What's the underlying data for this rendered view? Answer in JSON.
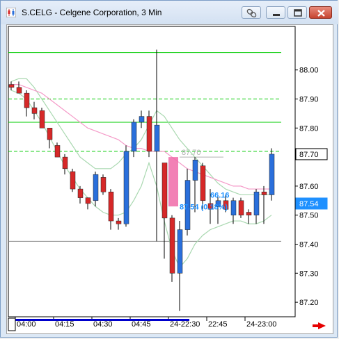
{
  "window": {
    "title": "S.CELG - Celgene Corporation, 3 Min",
    "buttons": [
      "link-icon",
      "minimize-icon",
      "maximize-icon",
      "close-icon"
    ]
  },
  "colors": {
    "up": "#2a6fdb",
    "down": "#d62828",
    "bb": "#a9d8b0",
    "ma": "#f59ac8",
    "level_green": "#00cc00",
    "highlight": "#f06aa8",
    "price_box_last": "#1e90ff",
    "scroll_arrow": "#e60000"
  },
  "chart_data": {
    "type": "candlestick",
    "symbol": "S.CELG",
    "interval": "3 Min",
    "ylim": [
      87.15,
      88.15
    ],
    "y_ticks": [
      "88.00",
      "87.90",
      "87.80",
      "87.70",
      "87.60",
      "87.50",
      "87.40",
      "87.30",
      "87.20"
    ],
    "x_tick_labels": [
      "04:00",
      "04:15",
      "04:30",
      "04:45",
      "24-22:30",
      "22:45",
      "24-23:00"
    ],
    "x_tick_index": [
      1,
      6,
      11,
      16,
      21,
      26,
      31
    ],
    "candles": [
      {
        "o": 87.95,
        "h": 87.96,
        "l": 87.93,
        "c": 87.94
      },
      {
        "o": 87.94,
        "h": 87.96,
        "l": 87.92,
        "c": 87.92
      },
      {
        "o": 87.92,
        "h": 87.93,
        "l": 87.84,
        "c": 87.87
      },
      {
        "o": 87.87,
        "h": 87.89,
        "l": 87.83,
        "c": 87.85
      },
      {
        "o": 87.86,
        "h": 87.87,
        "l": 87.8,
        "c": 87.8
      },
      {
        "o": 87.8,
        "h": 87.8,
        "l": 87.73,
        "c": 87.76
      },
      {
        "o": 87.74,
        "h": 87.75,
        "l": 87.7,
        "c": 87.7
      },
      {
        "o": 87.7,
        "h": 87.71,
        "l": 87.64,
        "c": 87.66
      },
      {
        "o": 87.65,
        "h": 87.66,
        "l": 87.58,
        "c": 87.59
      },
      {
        "o": 87.59,
        "h": 87.6,
        "l": 87.54,
        "c": 87.56
      },
      {
        "o": 87.56,
        "h": 87.56,
        "l": 87.52,
        "c": 87.54
      },
      {
        "o": 87.55,
        "h": 87.65,
        "l": 87.53,
        "c": 87.64
      },
      {
        "o": 87.63,
        "h": 87.64,
        "l": 87.57,
        "c": 87.58
      },
      {
        "o": 87.58,
        "h": 87.59,
        "l": 87.45,
        "c": 87.48
      },
      {
        "o": 87.48,
        "h": 87.49,
        "l": 87.45,
        "c": 87.47
      },
      {
        "o": 87.47,
        "h": 87.74,
        "l": 87.46,
        "c": 87.72
      },
      {
        "o": 87.72,
        "h": 87.83,
        "l": 87.7,
        "c": 87.82
      },
      {
        "o": 87.82,
        "h": 87.86,
        "l": 87.8,
        "c": 87.84
      },
      {
        "o": 87.84,
        "h": 87.86,
        "l": 87.7,
        "c": 87.72
      },
      {
        "o": 87.72,
        "h": 88.07,
        "l": 87.41,
        "c": 87.81
      },
      {
        "o": 87.68,
        "h": 87.68,
        "l": 87.35,
        "c": 87.49
      },
      {
        "o": 87.49,
        "h": 87.5,
        "l": 87.27,
        "c": 87.3
      },
      {
        "o": 87.3,
        "h": 87.48,
        "l": 87.17,
        "c": 87.45
      },
      {
        "o": 87.45,
        "h": 87.66,
        "l": 87.43,
        "c": 87.62
      },
      {
        "o": 87.62,
        "h": 87.7,
        "l": 87.51,
        "c": 87.69
      },
      {
        "o": 87.67,
        "h": 87.68,
        "l": 87.52,
        "c": 87.55
      },
      {
        "o": 87.54,
        "h": 87.59,
        "l": 87.47,
        "c": 87.52
      },
      {
        "o": 87.53,
        "h": 87.57,
        "l": 87.47,
        "c": 87.55
      },
      {
        "o": 87.55,
        "h": 87.57,
        "l": 87.51,
        "c": 87.52
      },
      {
        "o": 87.5,
        "h": 87.56,
        "l": 87.47,
        "c": 87.55
      },
      {
        "o": 87.55,
        "h": 87.56,
        "l": 87.49,
        "c": 87.5
      },
      {
        "o": 87.51,
        "h": 87.52,
        "l": 87.47,
        "c": 87.5
      },
      {
        "o": 87.5,
        "h": 87.59,
        "l": 87.47,
        "c": 87.58
      },
      {
        "o": 87.58,
        "h": 87.6,
        "l": 87.47,
        "c": 87.57
      },
      {
        "o": 87.57,
        "h": 87.73,
        "l": 87.55,
        "c": 87.71
      }
    ],
    "ma": [
      87.95,
      87.95,
      87.94,
      87.93,
      87.92,
      87.9,
      87.88,
      87.86,
      87.84,
      87.82,
      87.8,
      87.79,
      87.78,
      87.77,
      87.76,
      87.74,
      87.73,
      87.73,
      87.72,
      87.72,
      87.72,
      87.7,
      87.68,
      87.66,
      87.65,
      87.64,
      87.63,
      87.62,
      87.61,
      87.6,
      87.6,
      87.59,
      87.59,
      87.59,
      87.59
    ],
    "bb_upper": [
      87.96,
      87.97,
      87.97,
      87.94,
      87.9,
      87.86,
      87.82,
      87.78,
      87.74,
      87.7,
      87.68,
      87.66,
      87.66,
      87.66,
      87.68,
      87.71,
      87.73,
      87.76,
      87.81,
      87.86,
      87.84,
      87.8,
      87.76,
      87.73,
      87.7,
      87.67,
      87.64,
      87.61,
      87.59,
      87.58,
      87.57,
      87.57,
      87.57,
      87.57,
      87.57
    ],
    "bb_lower": [
      87.93,
      87.92,
      87.9,
      87.86,
      87.82,
      87.77,
      87.72,
      87.67,
      87.63,
      87.59,
      87.56,
      87.53,
      87.51,
      87.5,
      87.5,
      87.51,
      87.55,
      87.6,
      87.68,
      87.6,
      87.48,
      87.38,
      87.32,
      87.35,
      87.4,
      87.43,
      87.45,
      87.46,
      87.47,
      87.48,
      87.48,
      87.47,
      87.47,
      87.48,
      87.5
    ],
    "levels": [
      {
        "price": 88.06,
        "style": "solid",
        "color": "#00cc00"
      },
      {
        "price": 87.9,
        "style": "dashed",
        "color": "#00cc00"
      },
      {
        "price": 87.82,
        "style": "solid",
        "color": "#00cc00"
      },
      {
        "price": 87.72,
        "style": "dashed",
        "color": "#00cc00"
      },
      {
        "price": 87.41,
        "style": "solid",
        "color": "#888888"
      }
    ],
    "highlight_box": {
      "from_index": 21,
      "to_index": 21,
      "high": 87.7,
      "low": 87.53
    },
    "ref_line": {
      "price": 87.7,
      "from_index": 22,
      "to_index": 27,
      "label": "87.70"
    },
    "annotations": [
      {
        "text": "66.16",
        "price": 87.56,
        "index": 26,
        "color": "#1e90ff"
      },
      {
        "text": "87.54 (0.18%)",
        "price": 87.52,
        "index": 22,
        "color": "#1e90ff"
      }
    ],
    "price_boxes": [
      {
        "label": "87.70",
        "price": 87.71,
        "kind": "level"
      },
      {
        "label": "87.54",
        "price": 87.54,
        "kind": "last"
      }
    ]
  }
}
